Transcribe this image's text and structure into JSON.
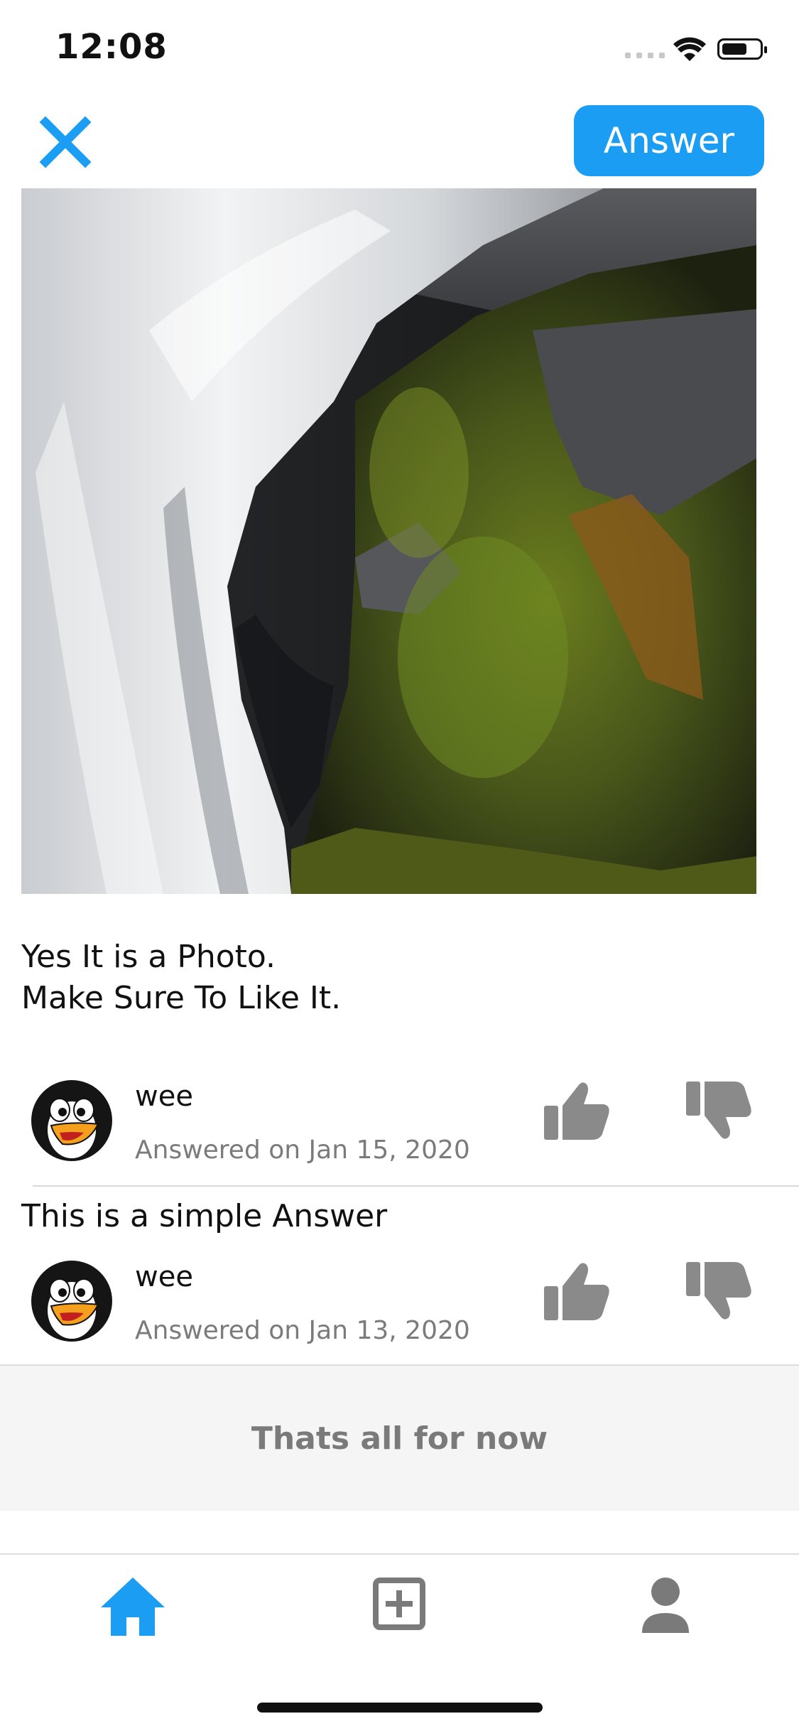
{
  "status_bar": {
    "time": "12:08"
  },
  "header": {
    "answer_label": "Answer"
  },
  "post": {
    "text_line1": "Yes It is a Photo.",
    "text_line2": "Make Sure To Like It."
  },
  "answers": [
    {
      "author": "wee",
      "date": "Answered on Jan 15, 2020",
      "text": ""
    },
    {
      "author": "wee",
      "date": "Answered on Jan 13, 2020",
      "text": "This is a simple Answer"
    }
  ],
  "footer": {
    "text": "Thats all for now"
  },
  "colors": {
    "accent": "#1a9df2",
    "thumb": "#8a8a8a",
    "footer_bg": "#f5f5f5"
  },
  "icons": [
    "close-icon",
    "thumbs-up-icon",
    "thumbs-down-icon",
    "home-icon",
    "add-box-icon",
    "person-icon"
  ]
}
